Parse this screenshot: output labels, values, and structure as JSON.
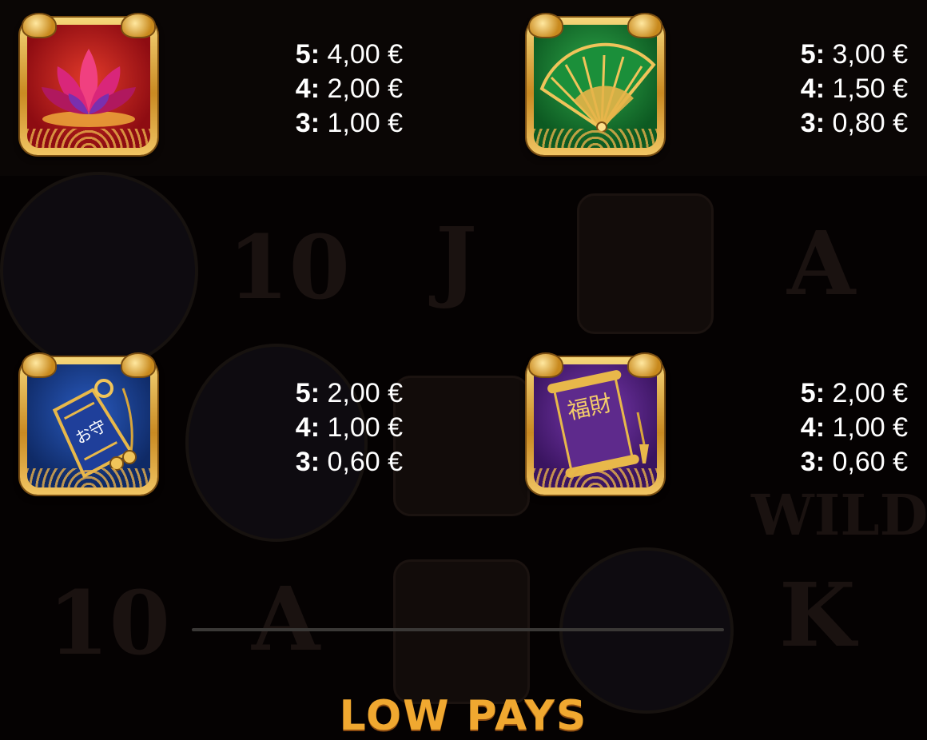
{
  "symbols": [
    {
      "name": "lotus-flower",
      "icon": "lotus-icon",
      "color": "#b5161b",
      "pays": [
        {
          "count": "5:",
          "value": "4,00 €"
        },
        {
          "count": "4:",
          "value": "2,00 €"
        },
        {
          "count": "3:",
          "value": "1,00 €"
        }
      ]
    },
    {
      "name": "folding-fan",
      "icon": "fan-icon",
      "color": "#1d7a2e",
      "pays": [
        {
          "count": "5:",
          "value": "3,00 €"
        },
        {
          "count": "4:",
          "value": "1,50 €"
        },
        {
          "count": "3:",
          "value": "0,80 €"
        }
      ]
    },
    {
      "name": "omamori-charm",
      "icon": "charm-icon",
      "color": "#1c3f8a",
      "charm_text": "お守",
      "pays": [
        {
          "count": "5:",
          "value": "2,00 €"
        },
        {
          "count": "4:",
          "value": "1,00 €"
        },
        {
          "count": "3:",
          "value": "0,60 €"
        }
      ]
    },
    {
      "name": "scroll",
      "icon": "scroll-icon",
      "color": "#5a2682",
      "scroll_text": "福財",
      "pays": [
        {
          "count": "5:",
          "value": "2,00 €"
        },
        {
          "count": "4:",
          "value": "1,00 €"
        },
        {
          "count": "3:",
          "value": "0,60 €"
        }
      ]
    }
  ],
  "section_heading": "LOW PAYS",
  "colors": {
    "gold_frame": "#e0a83c",
    "heading": "#f0a830",
    "text": "#ffffff",
    "background": "#050202"
  }
}
